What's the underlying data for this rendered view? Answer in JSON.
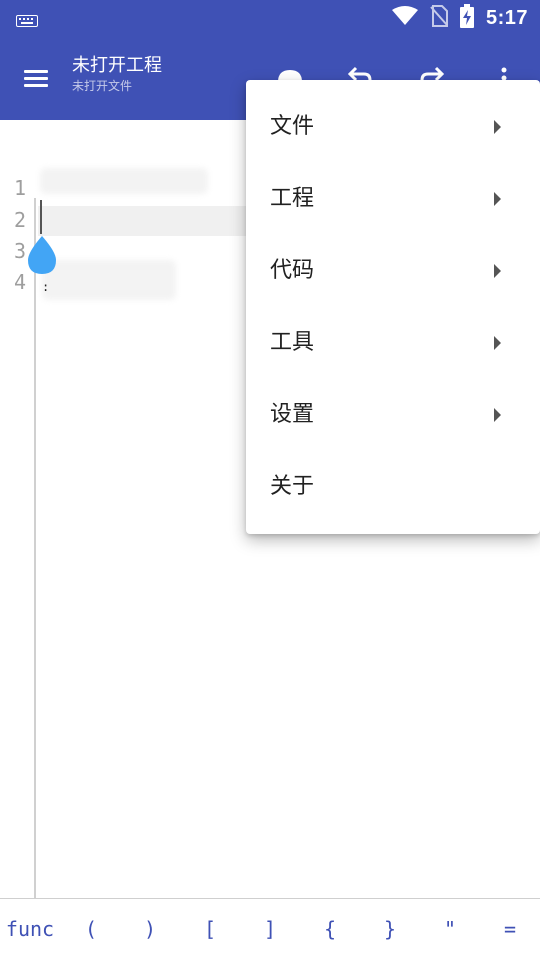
{
  "status_bar": {
    "time": "5:17",
    "icons": [
      "keyboard-icon",
      "wifi-icon",
      "no-sim-icon",
      "battery-charging-icon"
    ]
  },
  "app_bar": {
    "title": "未打开工程",
    "subtitle": "未打开文件",
    "icons": [
      "menu-icon",
      "save-icon",
      "undo-icon",
      "redo-icon",
      "more-vert-icon"
    ]
  },
  "editor": {
    "line_numbers": [
      "1",
      "2",
      "3",
      "4"
    ]
  },
  "popup_menu": {
    "items": [
      {
        "label": "文件",
        "has_submenu": true
      },
      {
        "label": "工程",
        "has_submenu": true
      },
      {
        "label": "代码",
        "has_submenu": true
      },
      {
        "label": "工具",
        "has_submenu": true
      },
      {
        "label": "设置",
        "has_submenu": true
      },
      {
        "label": "关于",
        "has_submenu": false
      }
    ]
  },
  "symbol_bar": {
    "symbols": [
      "func",
      "(",
      ")",
      "[",
      "]",
      "{",
      "}",
      "\"",
      "="
    ]
  },
  "colors": {
    "primary": "#3f51b5",
    "symbol_text": "#3f51b5",
    "drop_handle": "#42a5f5"
  }
}
